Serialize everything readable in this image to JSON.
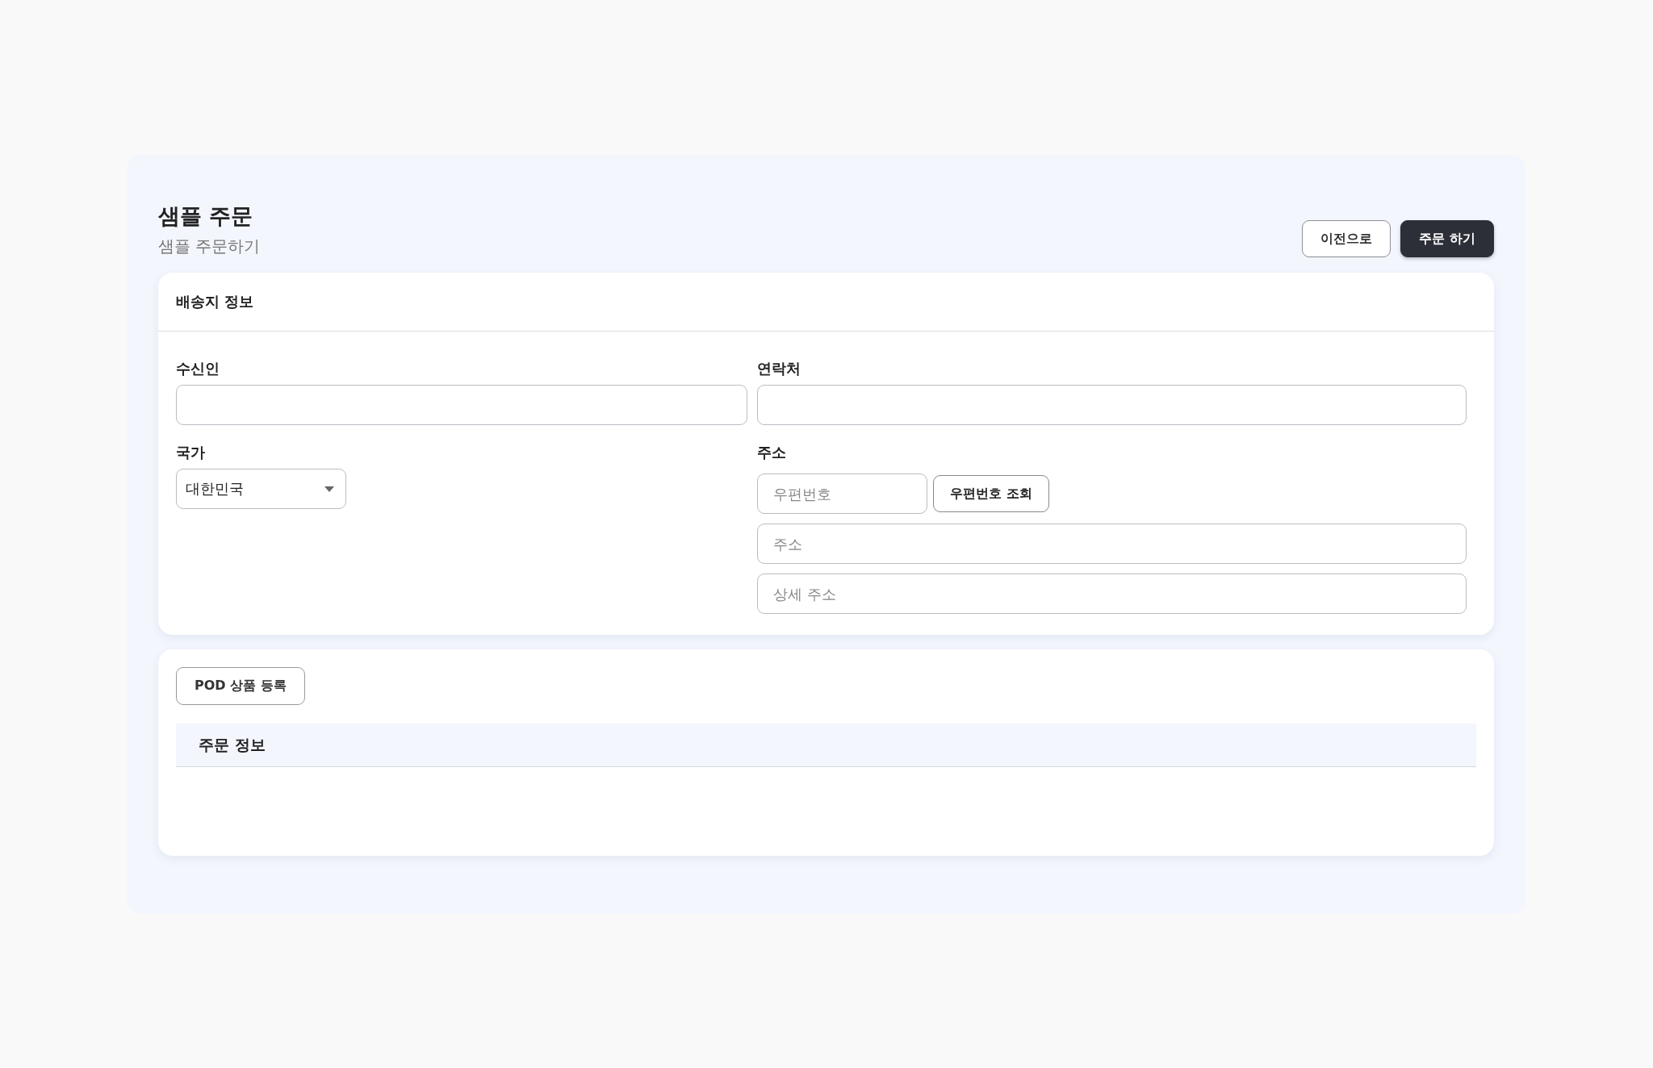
{
  "page": {
    "title": "샘플 주문",
    "subtitle": "샘플 주문하기"
  },
  "actions": [
    {
      "label": "이전으로",
      "kind": "secondary"
    },
    {
      "label": "주문 하기",
      "kind": "primary"
    }
  ],
  "shipping": {
    "title": "배송지 정보",
    "fields": [
      {
        "label": "수신인",
        "kind": "text"
      },
      {
        "label": "연락처",
        "kind": "text"
      },
      {
        "label": "국가",
        "kind": "select",
        "value": "대한민국"
      },
      {
        "label": "주소",
        "kind": "address",
        "zip_placeholder": "우편번호",
        "lookup_button": "우편번호 조회",
        "address_placeholder": "주소",
        "detail_placeholder": "상세 주소"
      }
    ]
  },
  "order": {
    "button": "POD 상품 등록",
    "table": {
      "columns": [
        "주문 정보"
      ]
    }
  }
}
